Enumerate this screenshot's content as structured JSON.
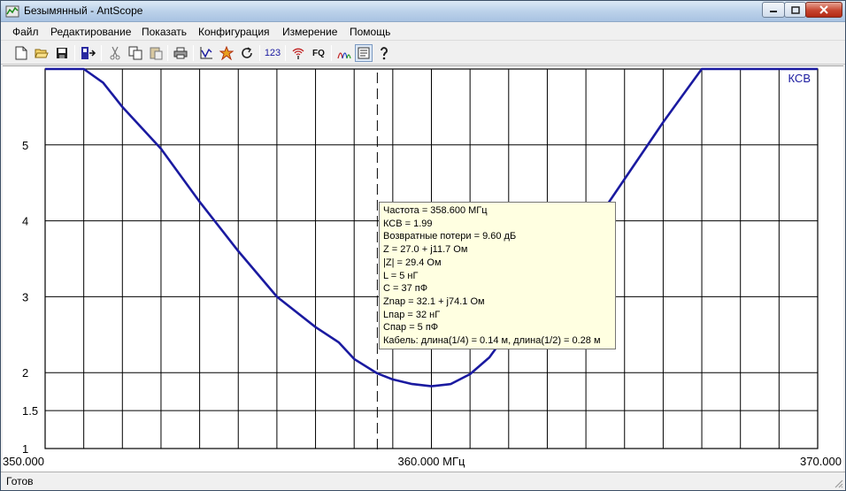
{
  "window": {
    "title": "Безымянный - AntScope"
  },
  "menu": {
    "items": [
      "Файл",
      "Редактирование",
      "Показать",
      "Конфигурация",
      "Измерение",
      "Помощь"
    ]
  },
  "toolbar": {
    "buttons": [
      {
        "name": "new-file-icon"
      },
      {
        "name": "open-folder-icon"
      },
      {
        "name": "save-icon"
      },
      {
        "name": "export-icon"
      },
      {
        "name": "cut-icon"
      },
      {
        "name": "copy-icon"
      },
      {
        "name": "paste-icon"
      },
      {
        "name": "print-icon"
      },
      {
        "name": "chart-icon"
      },
      {
        "name": "calibrate-icon"
      },
      {
        "name": "refresh-icon"
      },
      {
        "name": "numeric-icon",
        "text": "123"
      },
      {
        "name": "signal-icon"
      },
      {
        "name": "fq-icon",
        "text": "FQ"
      },
      {
        "name": "markers-icon"
      },
      {
        "name": "legend-icon"
      },
      {
        "name": "help-icon"
      }
    ]
  },
  "status": {
    "text": "Готов"
  },
  "chart_data": {
    "type": "line",
    "series": [
      {
        "name": "КСВ",
        "color": "#1a1aa0",
        "x": [
          350.0,
          351.0,
          351.5,
          352.0,
          353.0,
          354.0,
          355.0,
          356.0,
          357.0,
          357.6,
          358.0,
          358.6,
          359.0,
          359.5,
          360.0,
          360.5,
          361.0,
          361.5,
          362.0,
          363.0,
          364.0,
          365.0,
          366.0,
          366.5,
          367.0,
          368.0,
          369.0,
          370.0
        ],
        "y": [
          6.0,
          6.0,
          5.82,
          5.5,
          4.95,
          4.25,
          3.6,
          3.0,
          2.6,
          2.4,
          2.18,
          1.99,
          1.91,
          1.85,
          1.82,
          1.85,
          1.98,
          2.2,
          2.55,
          3.1,
          3.8,
          4.55,
          5.3,
          5.65,
          6.0,
          6.0,
          6.0,
          6.0
        ]
      }
    ],
    "cursor_x": 358.6,
    "xlim": [
      350.0,
      370.0
    ],
    "ylim": [
      1,
      6
    ],
    "x_ticks": [
      {
        "value": 350.0,
        "label": "350.000"
      },
      {
        "value": 360.0,
        "label": "360.000 МГц"
      },
      {
        "value": 370.0,
        "label": "370.000"
      }
    ],
    "y_ticks": [
      {
        "value": 5,
        "label": "5"
      },
      {
        "value": 4,
        "label": "4"
      },
      {
        "value": 3,
        "label": "3"
      },
      {
        "value": 2,
        "label": "2"
      },
      {
        "value": 1.5,
        "label": "1.5"
      },
      {
        "value": 1,
        "label": "1"
      }
    ],
    "x_grid_count": 20,
    "y_grid": [
      5,
      4,
      3,
      2,
      1.5
    ],
    "grid": true,
    "legend": "top-right",
    "legend_label": "КСВ"
  },
  "tooltip": {
    "lines": [
      "Частота = 358.600 МГц",
      "КСВ = 1.99",
      "Возвратные потери = 9.60 дБ",
      "Z = 27.0 + j11.7 Ом",
      "|Z| = 29.4 Ом",
      "L = 5 нГ",
      "C = 37 пФ",
      "Znар = 32.1 + j74.1 Ом",
      "Lпар = 32 нГ",
      "Cпар = 5 пФ",
      "Кабель: длина(1/4) = 0.14 м, длина(1/2) = 0.28 м"
    ]
  }
}
